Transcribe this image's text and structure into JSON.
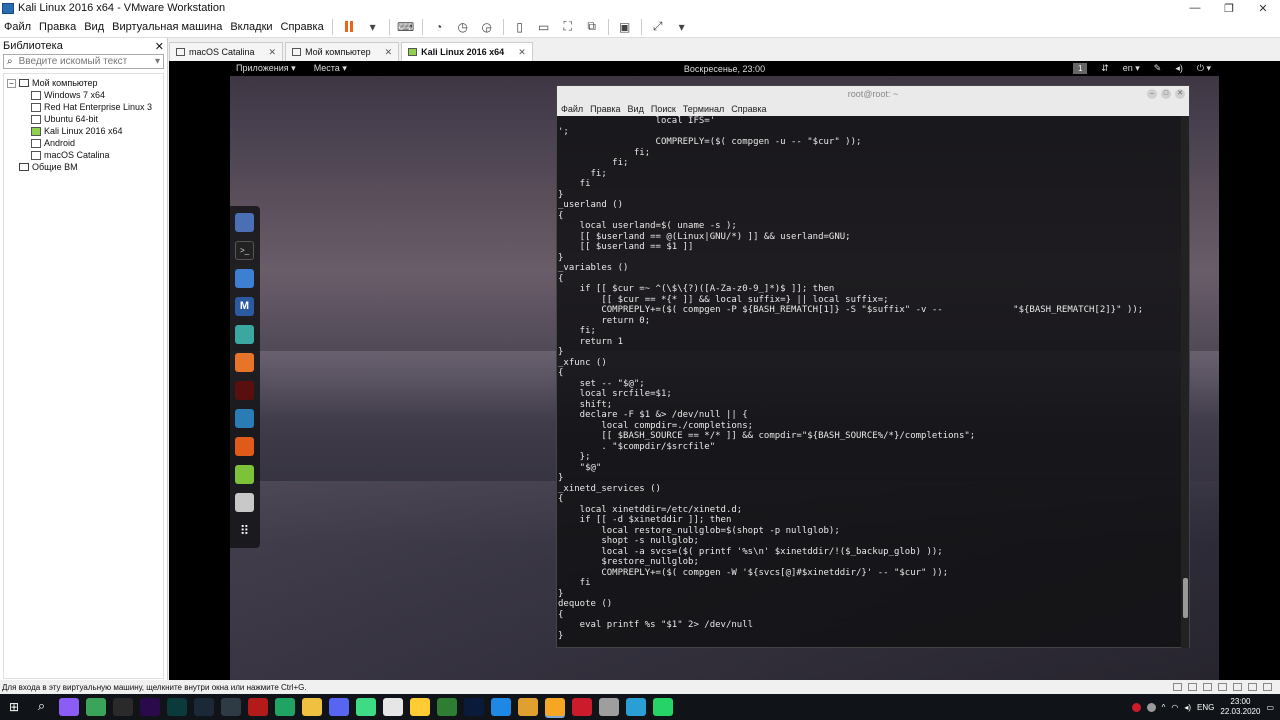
{
  "window": {
    "title": "Kali Linux 2016 x64 - VMware Workstation",
    "controls": [
      "—",
      "❐",
      "✕"
    ]
  },
  "menu": [
    "Файл",
    "Правка",
    "Вид",
    "Виртуальная машина",
    "Вкладки",
    "Справка"
  ],
  "library": {
    "title": "Библиотека",
    "close": "✕",
    "search_placeholder": "Введите искомый текст",
    "tree": [
      {
        "label": "Мой компьютер",
        "level": 0,
        "type": "root"
      },
      {
        "label": "Windows 7 x64",
        "level": 1,
        "type": "vm"
      },
      {
        "label": "Red Hat Enterprise Linux 3",
        "level": 1,
        "type": "vm"
      },
      {
        "label": "Ubuntu 64-bit",
        "level": 1,
        "type": "vm"
      },
      {
        "label": "Kali Linux 2016 x64",
        "level": 1,
        "type": "vm-active"
      },
      {
        "label": "Android",
        "level": 1,
        "type": "vm"
      },
      {
        "label": "macOS Catalina",
        "level": 1,
        "type": "vm"
      },
      {
        "label": "Общие ВМ",
        "level": 0,
        "type": "shared"
      }
    ]
  },
  "tabs": [
    {
      "label": "macOS Catalina",
      "active": false
    },
    {
      "label": "Мой компьютер",
      "active": false
    },
    {
      "label": "Kali Linux 2016 x64",
      "active": true
    }
  ],
  "guest": {
    "top_left": [
      "Приложения ▾",
      "Места ▾"
    ],
    "clock": "Воскресенье, 23:00",
    "workspace": "1",
    "lang": "en ▾"
  },
  "terminal": {
    "title": "root@root: ~",
    "menu": [
      "Файл",
      "Правка",
      "Вид",
      "Поиск",
      "Терминал",
      "Справка"
    ],
    "content": "                  local IFS='\n';\n                  COMPREPLY=($( compgen -u -- \"$cur\" ));\n              fi;\n          fi;\n      fi;\n    fi\n}\n_userland ()\n{\n    local userland=$( uname -s );\n    [[ $userland == @(Linux|GNU/*) ]] && userland=GNU;\n    [[ $userland == $1 ]]\n}\n_variables ()\n{\n    if [[ $cur =~ ^(\\$\\{?)([A-Za-z0-9_]*)$ ]]; then\n        [[ $cur == *{* ]] && local suffix=} || local suffix=;\n        COMPREPLY+=($( compgen -P ${BASH_REMATCH[1]} -S \"$suffix\" -v --             \"${BASH_REMATCH[2]}\" ));\n        return 0;\n    fi;\n    return 1\n}\n_xfunc ()\n{\n    set -- \"$@\";\n    local srcfile=$1;\n    shift;\n    declare -F $1 &> /dev/null || {\n        local compdir=./completions;\n        [[ $BASH_SOURCE == */* ]] && compdir=\"${BASH_SOURCE%/*}/completions\";\n        . \"$compdir/$srcfile\"\n    };\n    \"$@\"\n}\n_xinetd_services ()\n{\n    local xinetddir=/etc/xinetd.d;\n    if [[ -d $xinetddir ]]; then\n        local restore_nullglob=$(shopt -p nullglob);\n        shopt -s nullglob;\n        local -a svcs=($( printf '%s\\n' $xinetddir/!($_backup_glob) ));\n        $restore_nullglob;\n        COMPREPLY+=($( compgen -W '${svcs[@]#$xinetddir/}' -- \"$cur\" ));\n    fi\n}\ndequote ()\n{\n    eval printf %s \"$1\" 2> /dev/null\n}"
  },
  "status": {
    "text": "Для входа в эту виртуальную машину, щелкните внутри окна или нажмите Ctrl+G."
  },
  "taskbar": {
    "lang": "ENG",
    "time": "23:00",
    "date": "22.03.2020",
    "apps": [
      {
        "name": "search",
        "color": "#101418"
      },
      {
        "name": "cortana",
        "color": "#8b5cf6"
      },
      {
        "name": "chrome-like",
        "color": "#3aa55a"
      },
      {
        "name": "terminal",
        "color": "#2a2a2a"
      },
      {
        "name": "premiere",
        "color": "#2a0a4a"
      },
      {
        "name": "audition",
        "color": "#0a3a3a"
      },
      {
        "name": "steam",
        "color": "#1b2838"
      },
      {
        "name": "box",
        "color": "#2e3a44"
      },
      {
        "name": "filezilla",
        "color": "#b31b1b"
      },
      {
        "name": "s-app",
        "color": "#1fa463"
      },
      {
        "name": "explorer",
        "color": "#f0c040"
      },
      {
        "name": "discord",
        "color": "#5865f2"
      },
      {
        "name": "android",
        "color": "#3ddc84"
      },
      {
        "name": "yandex",
        "color": "#e6e6e6"
      },
      {
        "name": "smiley",
        "color": "#ffcc33"
      },
      {
        "name": "maps",
        "color": "#2e7d32"
      },
      {
        "name": "photoshop",
        "color": "#0a1a3a"
      },
      {
        "name": "vscode",
        "color": "#1e88e5"
      },
      {
        "name": "folder",
        "color": "#e0a030"
      },
      {
        "name": "vmware",
        "color": "#f5a623"
      },
      {
        "name": "opera",
        "color": "#cc1b2b"
      },
      {
        "name": "paint",
        "color": "#9e9e9e"
      },
      {
        "name": "telegram-like",
        "color": "#2a9fd6"
      },
      {
        "name": "whatsapp",
        "color": "#25d366"
      }
    ]
  }
}
